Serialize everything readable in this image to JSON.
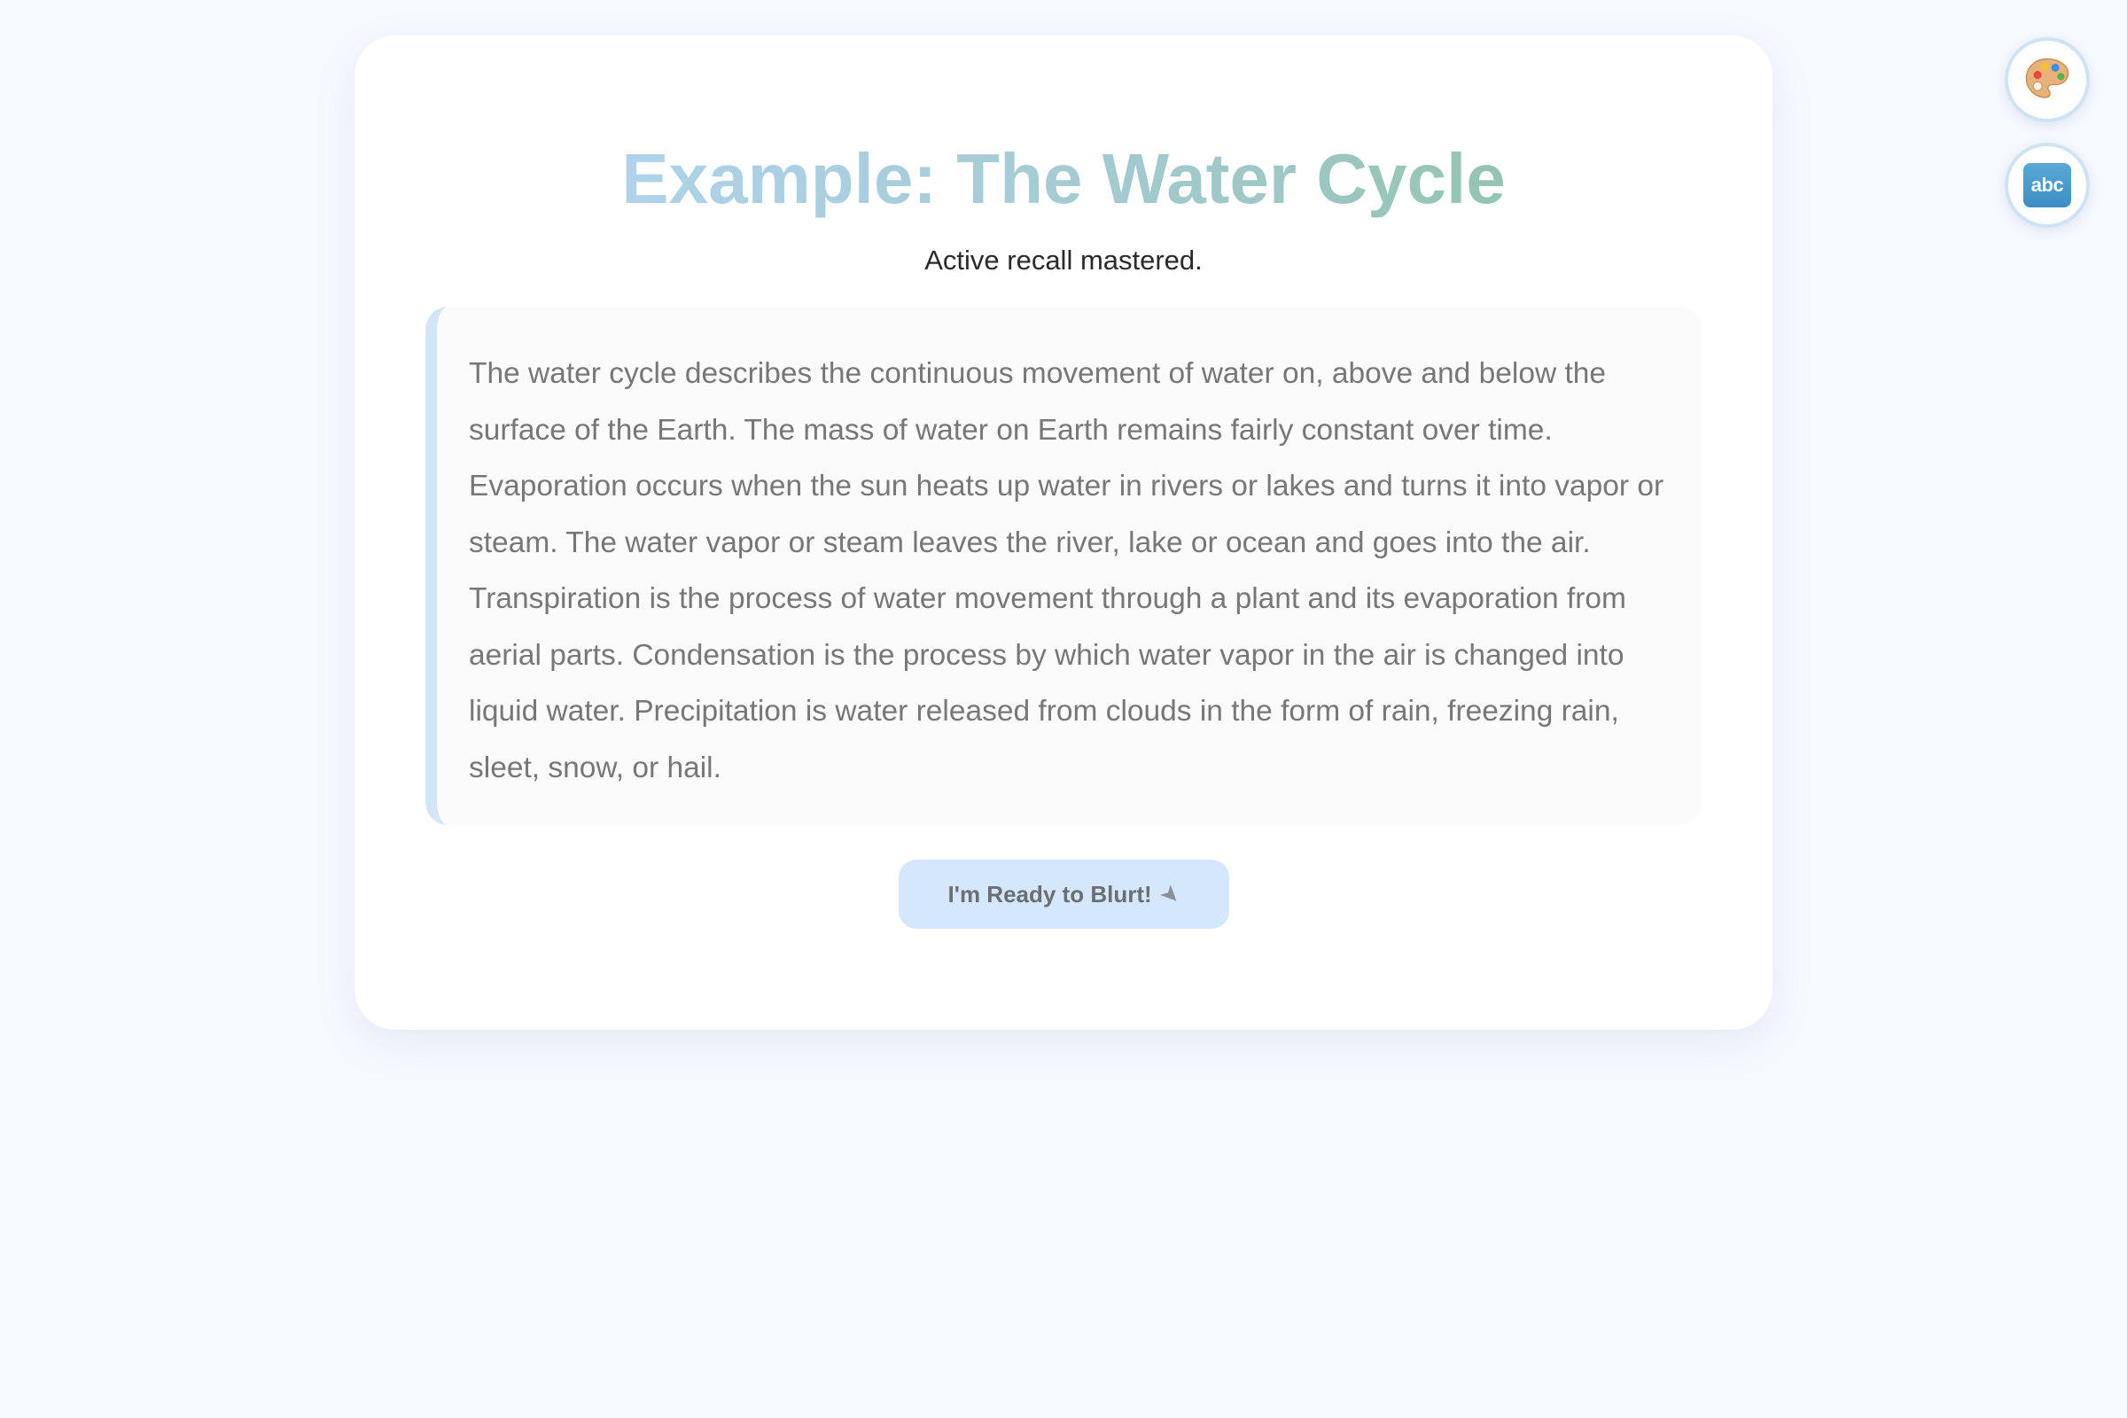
{
  "card": {
    "title": "Example: The Water Cycle",
    "subtitle": "Active recall mastered.",
    "passage": "The water cycle describes the continuous movement of water on, above and below the surface of the Earth. The mass of water on Earth remains fairly constant over time. Evaporation occurs when the sun heats up water in rivers or lakes and turns it into vapor or steam. The water vapor or steam leaves the river, lake or ocean and goes into the air. Transpiration is the process of water movement through a plant and its evaporation from aerial parts. Condensation is the process by which water vapor in the air is changed into liquid water. Precipitation is water released from clouds in the form of rain, freezing rain, sleet, snow, or hail.",
    "button_label": "I'm Ready to Blurt!",
    "button_icon": "rocket-icon"
  },
  "floating_buttons": [
    {
      "icon": "palette-icon"
    },
    {
      "icon": "abc-icon",
      "glyph": "abc"
    }
  ],
  "colors": {
    "background": "#f6f9fe",
    "title_gradient_start": "#aed3eb",
    "title_gradient_end": "#94c4b3",
    "accent": "#d4e7fc",
    "passage_border": "#d3e6f7"
  }
}
